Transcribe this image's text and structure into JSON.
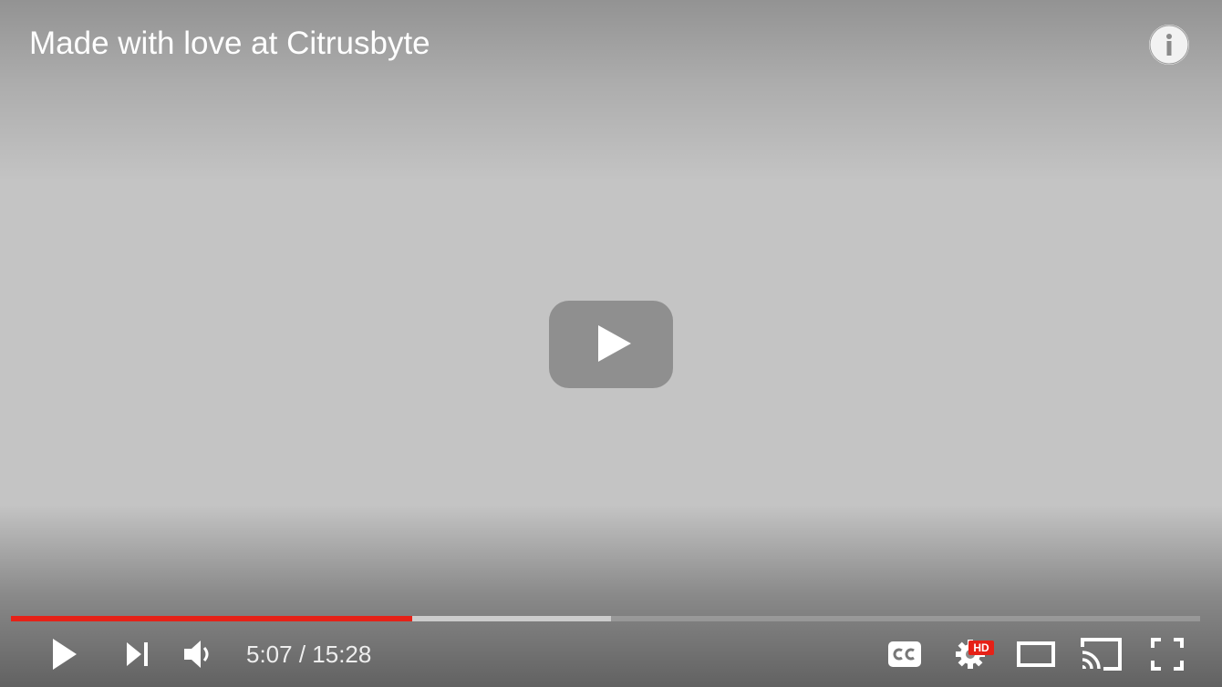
{
  "video": {
    "title": "Made with love at Citrusbyte"
  },
  "progress": {
    "played_fraction": 0.3374,
    "loaded_fraction": 0.5046
  },
  "time": {
    "display": "5:07 / 15:28"
  },
  "settings": {
    "quality_badge": "HD"
  },
  "icons": {
    "info": "info-icon",
    "big_play": "play-icon",
    "play": "play-icon",
    "next": "skip-next-icon",
    "volume": "volume-icon",
    "captions": "closed-captions-icon",
    "settings": "gear-icon",
    "theater": "theater-mode-icon",
    "cast": "cast-icon",
    "fullscreen": "fullscreen-icon"
  },
  "colors": {
    "accent": "#e62117",
    "background": "#c4c4c4",
    "big_play_bg": "#8f8f8f"
  }
}
